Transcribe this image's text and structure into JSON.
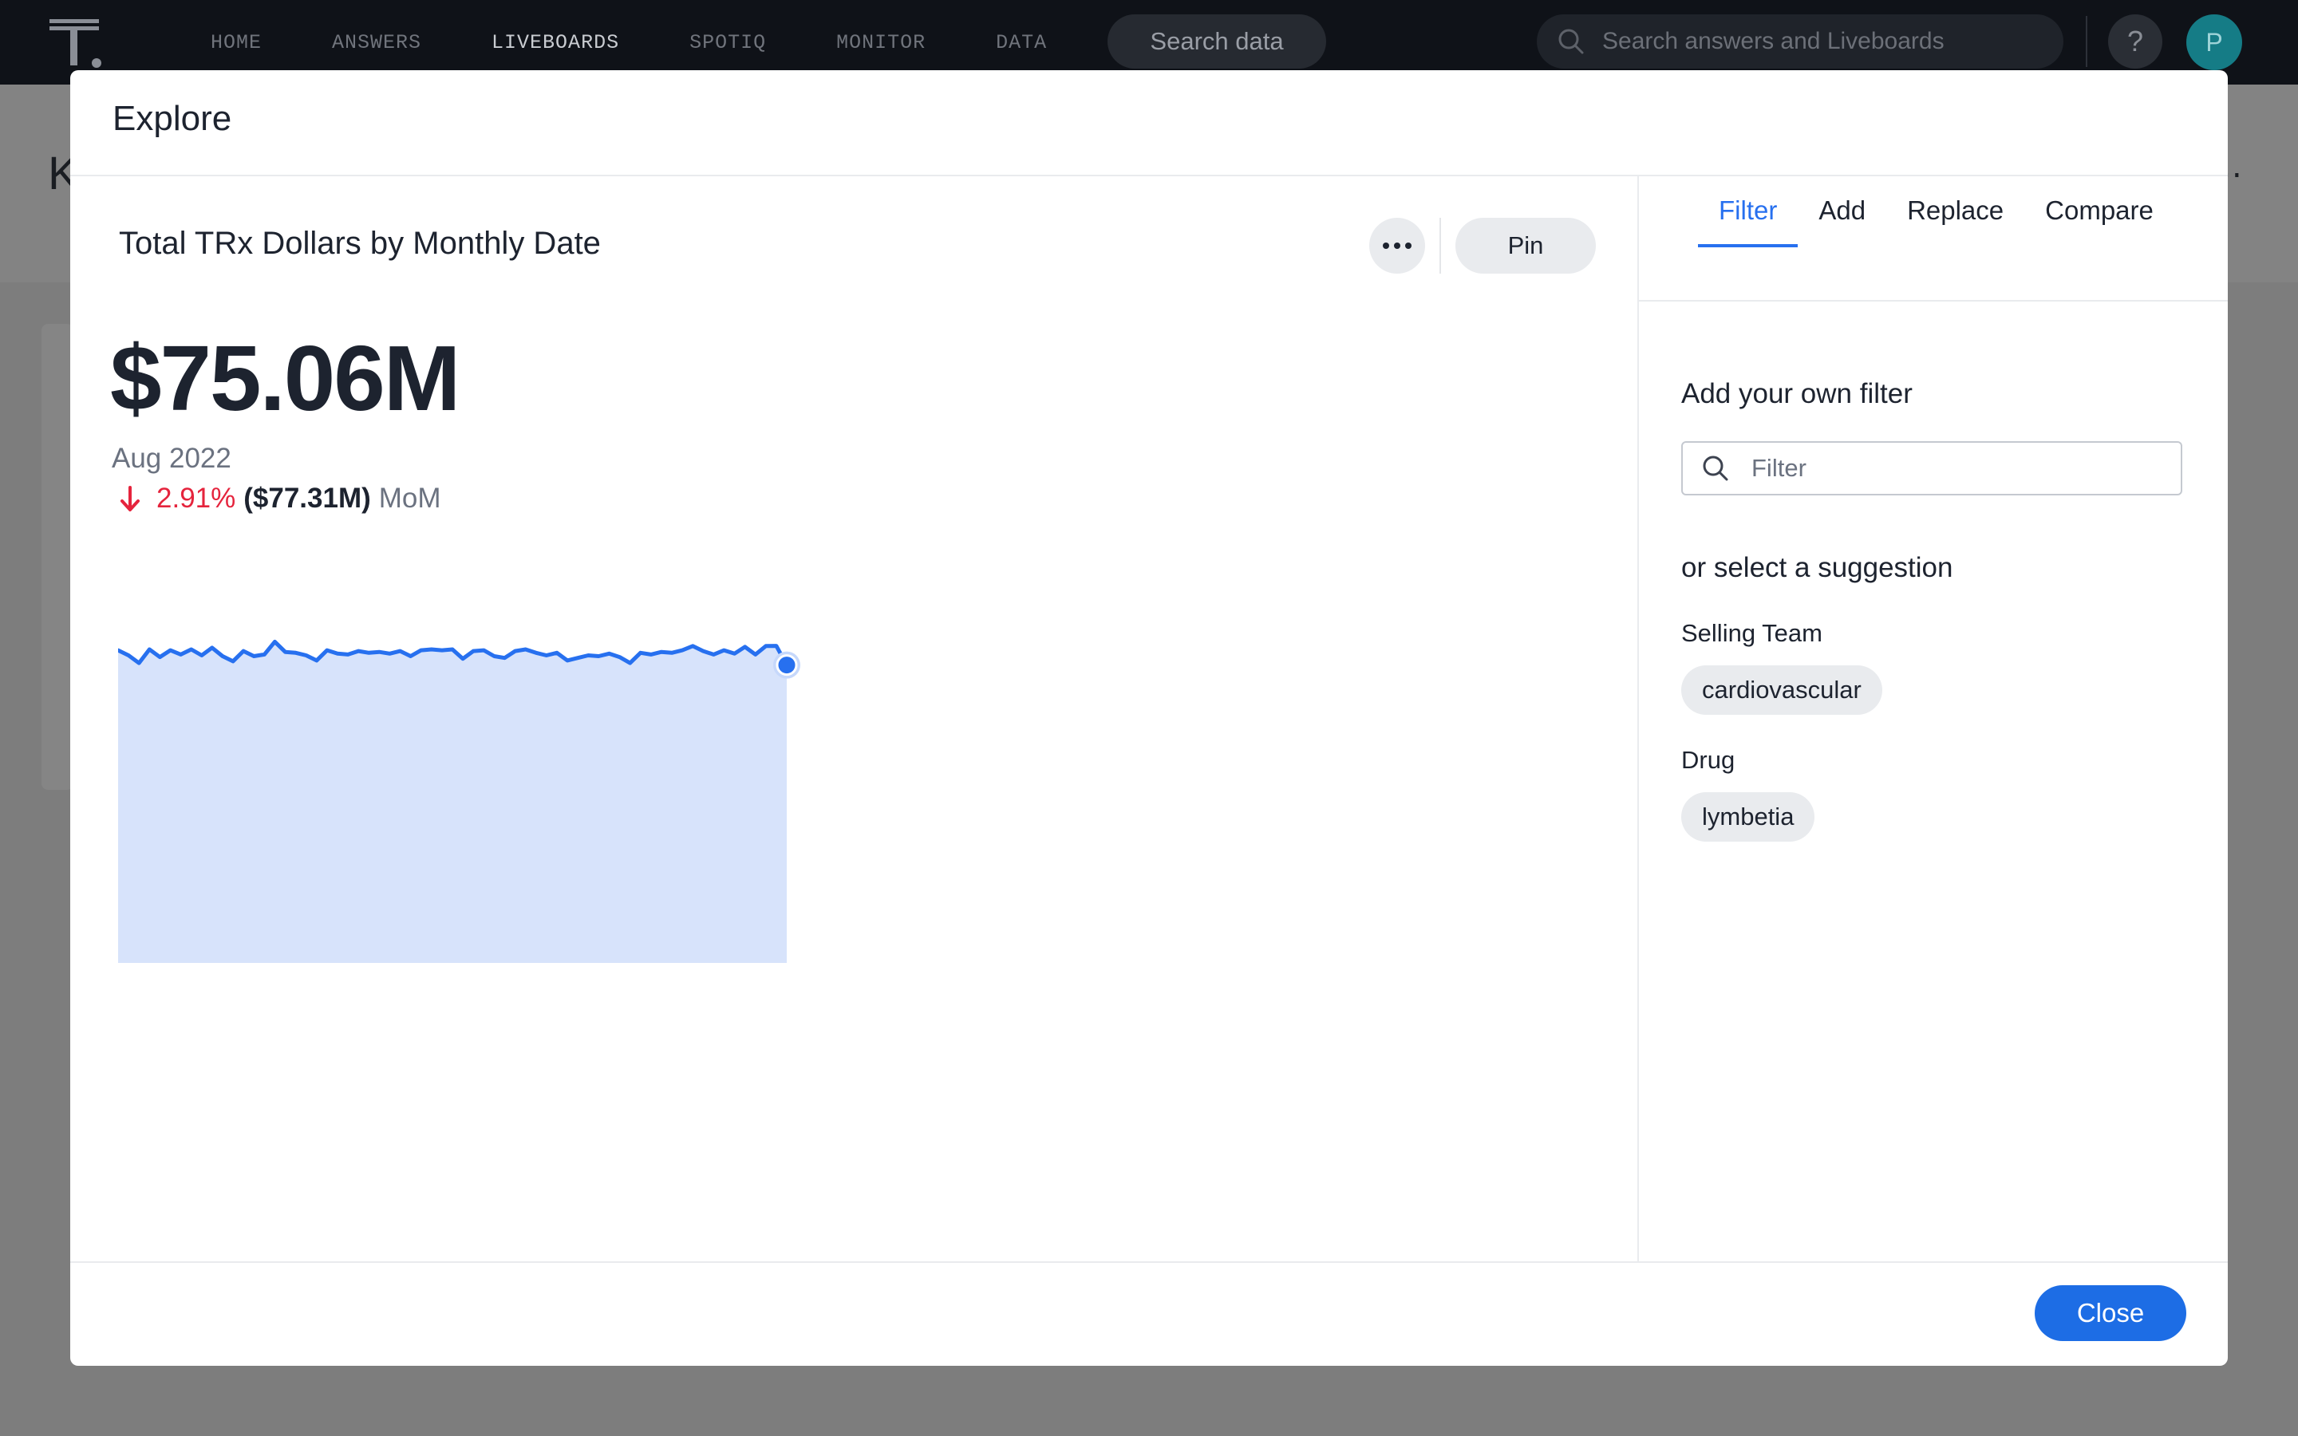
{
  "nav": {
    "items": [
      "HOME",
      "ANSWERS",
      "LIVEBOARDS",
      "SPOTIQ",
      "MONITOR",
      "DATA"
    ],
    "active": "LIVEBOARDS",
    "search_data_label": "Search data",
    "search_answers_placeholder": "Search answers and Liveboards",
    "help_label": "?",
    "avatar_initial": "P"
  },
  "background": {
    "title_initial": "K",
    "menu_glyph": "⋯"
  },
  "modal": {
    "title": "Explore",
    "close_label": "Close"
  },
  "viz": {
    "title": "Total TRx Dollars by Monthly Date",
    "more_label": "•••",
    "pin_label": "Pin",
    "kpi_value": "$75.06M",
    "kpi_period": "Aug 2022",
    "change_pct": "2.91%",
    "change_prev": "($77.31M)",
    "change_basis": "MoM",
    "change_direction": "down",
    "colors": {
      "line": "#2770ef",
      "area": "#d7e3fb",
      "negative": "#e5243d"
    }
  },
  "chart_data": {
    "type": "area",
    "title": "",
    "xlabel": "",
    "ylabel": "",
    "highlight": "last",
    "values": [
      76.8,
      76.2,
      75.3,
      76.9,
      76.0,
      76.8,
      76.3,
      76.9,
      76.2,
      77.1,
      76.1,
      75.5,
      76.7,
      76.1,
      76.3,
      77.8,
      76.6,
      76.5,
      76.2,
      75.6,
      76.8,
      76.4,
      76.3,
      76.7,
      76.5,
      76.6,
      76.4,
      76.7,
      76.1,
      76.8,
      76.9,
      76.8,
      76.9,
      75.8,
      76.7,
      76.8,
      76.1,
      75.9,
      76.7,
      76.9,
      76.5,
      76.2,
      76.5,
      75.6,
      75.9,
      76.2,
      76.1,
      76.4,
      76.0,
      75.3,
      76.5,
      76.3,
      76.6,
      76.5,
      76.8,
      77.3,
      76.7,
      76.3,
      76.8,
      76.4,
      77.2,
      76.3,
      77.3,
      77.31,
      75.06
    ],
    "ylim": [
      40,
      80
    ]
  },
  "panel": {
    "tabs": [
      "Filter",
      "Add",
      "Replace",
      "Compare"
    ],
    "active_tab": "Filter",
    "own_filter_heading": "Add your own filter",
    "filter_placeholder": "Filter",
    "suggestion_heading": "or select a suggestion",
    "suggestions": [
      {
        "label": "Selling Team",
        "chip": "cardiovascular"
      },
      {
        "label": "Drug",
        "chip": "lymbetia"
      }
    ]
  }
}
